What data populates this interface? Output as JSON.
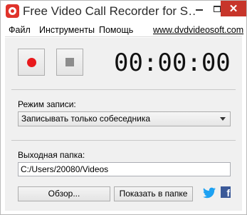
{
  "window": {
    "title": "Free Video Call Recorder for S…",
    "close_glyph": "✕"
  },
  "menu": {
    "file": "Файл",
    "tools": "Инструменты",
    "help": "Помощь",
    "website": "www.dvdvideosoft.com"
  },
  "recorder": {
    "timer": "00:00:00"
  },
  "mode": {
    "label": "Режим записи:",
    "selected": "Записывать только собеседника"
  },
  "output": {
    "label": "Выходная папка:",
    "path": "C:/Users/20080/Videos"
  },
  "buttons": {
    "browse": "Обзор...",
    "show_in_folder": "Показать в папке"
  },
  "social": {
    "facebook_glyph": "f"
  },
  "colors": {
    "accent_red": "#e0332b",
    "close_red": "#c7352a",
    "record_red": "#e8191c",
    "twitter_blue": "#1da1f2",
    "facebook_blue": "#3b5998",
    "panel_bg": "#f0f0f0"
  },
  "icons": {
    "app": "app-logo-icon",
    "record": "record-icon",
    "stop": "stop-icon",
    "twitter": "twitter-icon",
    "facebook": "facebook-icon"
  }
}
